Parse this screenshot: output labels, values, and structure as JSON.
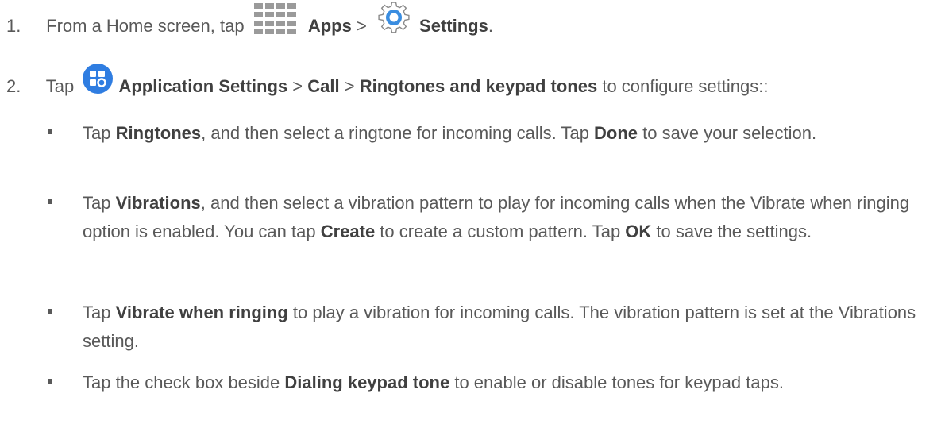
{
  "step1": {
    "number": "1.",
    "prefix": "From a Home screen, tap",
    "apps": "Apps",
    "sep": ">",
    "settings": "Settings",
    "end": "."
  },
  "step2": {
    "number": "2.",
    "tap": "Tap",
    "app_settings": "Application Settings",
    "sep1": ">",
    "call": "Call",
    "sep2": ">",
    "ringtones_keypad": "Ringtones and keypad tones",
    "rest": "to configure settings::"
  },
  "bullets": [
    {
      "t1": "Tap ",
      "b1": "Ringtones",
      "t2": ", and then select a ringtone for incoming calls. Tap ",
      "b2": "Done",
      "t3": " to save your selection."
    },
    {
      "t1": "Tap ",
      "b1": "Vibrations",
      "t2": ", and then select a vibration pattern to play for incoming calls when the Vibrate when ringing option is enabled. You can tap ",
      "b2": "Create",
      "t3": " to create a custom pattern. Tap ",
      "b3": "OK",
      "t4": " to save the settings."
    },
    {
      "t1": "Tap ",
      "b1": "Vibrate when ringing",
      "t2": " to play a vibration for incoming calls. The vibration pattern is set at the Vibrations setting."
    },
    {
      "t1": "Tap the check box beside ",
      "b1": "Dialing keypad tone",
      "t2": " to enable or disable tones for keypad taps."
    }
  ],
  "icons": {
    "apps": "apps-grid-icon",
    "settings": "settings-gear-icon",
    "app_settings": "application-settings-icon"
  },
  "colors": {
    "text": "#595959",
    "bold": "#404040",
    "apps_grid": "#9a9a9a",
    "app_settings_bg": "#2f7de1",
    "gear": "#3a8de0"
  }
}
